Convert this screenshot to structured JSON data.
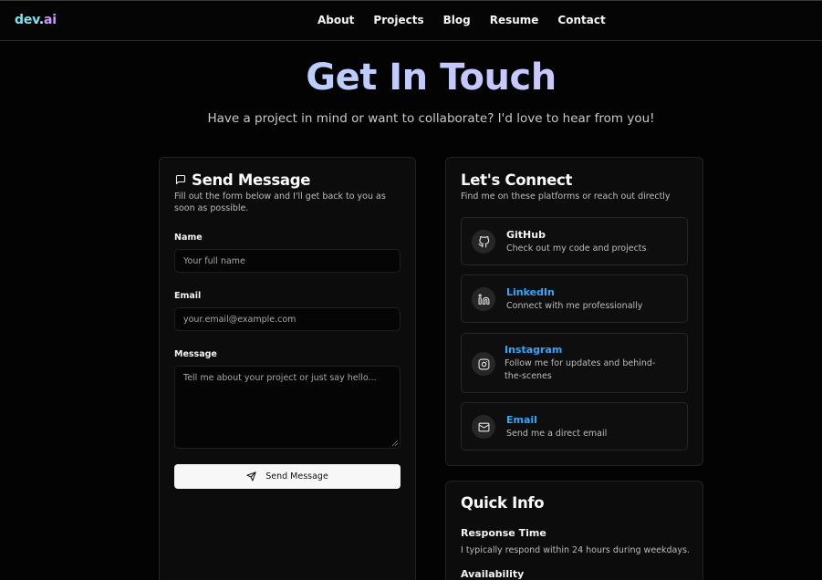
{
  "logo": {
    "dev": "dev",
    "dot": ".",
    "ai": "ai"
  },
  "nav": {
    "items": [
      "About",
      "Projects",
      "Blog",
      "Resume",
      "Contact"
    ]
  },
  "hero": {
    "title": "Get In Touch",
    "subtitle": "Have a project in mind or want to collaborate? I'd love to hear from you!"
  },
  "form": {
    "title": "Send Message",
    "description": "Fill out the form below and I'll get back to you as soon as possible.",
    "name_label": "Name",
    "name_placeholder": "Your full name",
    "email_label": "Email",
    "email_placeholder": "your.email@example.com",
    "message_label": "Message",
    "message_placeholder": "Tell me about your project or just say hello...",
    "submit_label": "Send Message"
  },
  "connect": {
    "title": "Let's Connect",
    "description": "Find me on these platforms or reach out directly",
    "items": [
      {
        "name": "GitHub",
        "desc": "Check out my code and projects",
        "icon": "github-icon",
        "color": "#f4f4f4"
      },
      {
        "name": "LinkedIn",
        "desc": "Connect with me professionally",
        "icon": "linkedin-icon",
        "color": "#2ea8ff"
      },
      {
        "name": "Instagram",
        "desc": "Follow me for updates and behind-the-scenes",
        "icon": "instagram-icon",
        "color": "#2ea8ff"
      },
      {
        "name": "Email",
        "desc": "Send me a direct email",
        "icon": "mail-icon",
        "color": "#2ea8ff"
      }
    ]
  },
  "info": {
    "title": "Quick Info",
    "response_label": "Response Time",
    "response_text": "I typically respond within 24 hours during weekdays.",
    "availability_label": "Availability"
  },
  "colors": {
    "background": "#030303",
    "card": "#0c0c0c",
    "accent_link": "#2ea8ff",
    "button": "#f7f7f7"
  }
}
